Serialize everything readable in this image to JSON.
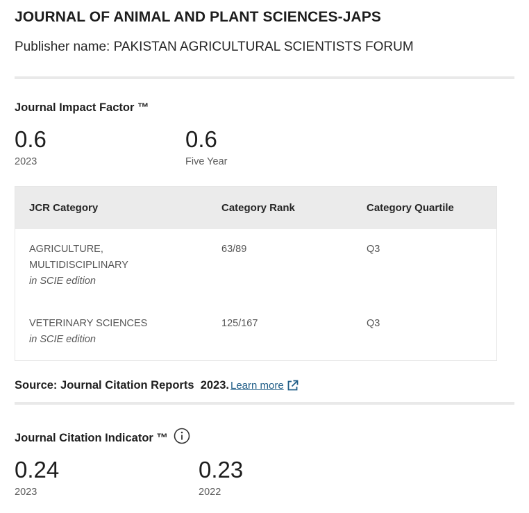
{
  "journal": {
    "title": "JOURNAL OF ANIMAL AND PLANT SCIENCES-JAPS",
    "publisher": "Publisher name: PAKISTAN AGRICULTURAL SCIENTISTS FORUM"
  },
  "impact_factor": {
    "title": "Journal Impact Factor ™",
    "metrics": [
      {
        "value": "0.6",
        "label": "2023"
      },
      {
        "value": "0.6",
        "label": "Five Year"
      }
    ]
  },
  "table": {
    "headers": [
      "JCR Category",
      "Category Rank",
      "Category Quartile"
    ],
    "rows": [
      {
        "category_line1": "AGRICULTURE,",
        "category_line2": "MULTIDISCIPLINARY",
        "edition": "in SCIE edition",
        "rank": "63/89",
        "quartile": "Q3"
      },
      {
        "category_line1": "VETERINARY SCIENCES",
        "category_line2": "",
        "edition": "in SCIE edition",
        "rank": "125/167",
        "quartile": "Q3"
      }
    ]
  },
  "source": {
    "text": "Source: Journal Citation Reports  2023.",
    "link_label": " Learn more",
    "link_icon": "external-link-icon"
  },
  "citation_indicator": {
    "title": "Journal Citation Indicator ™",
    "info_icon": "info-icon",
    "metrics": [
      {
        "value": "0.24",
        "label": "2023"
      },
      {
        "value": "0.23",
        "label": "2022"
      }
    ]
  },
  "colors": {
    "link": "#1f5d87",
    "header_bg": "#ebebeb",
    "divider": "#e9e9e9"
  }
}
